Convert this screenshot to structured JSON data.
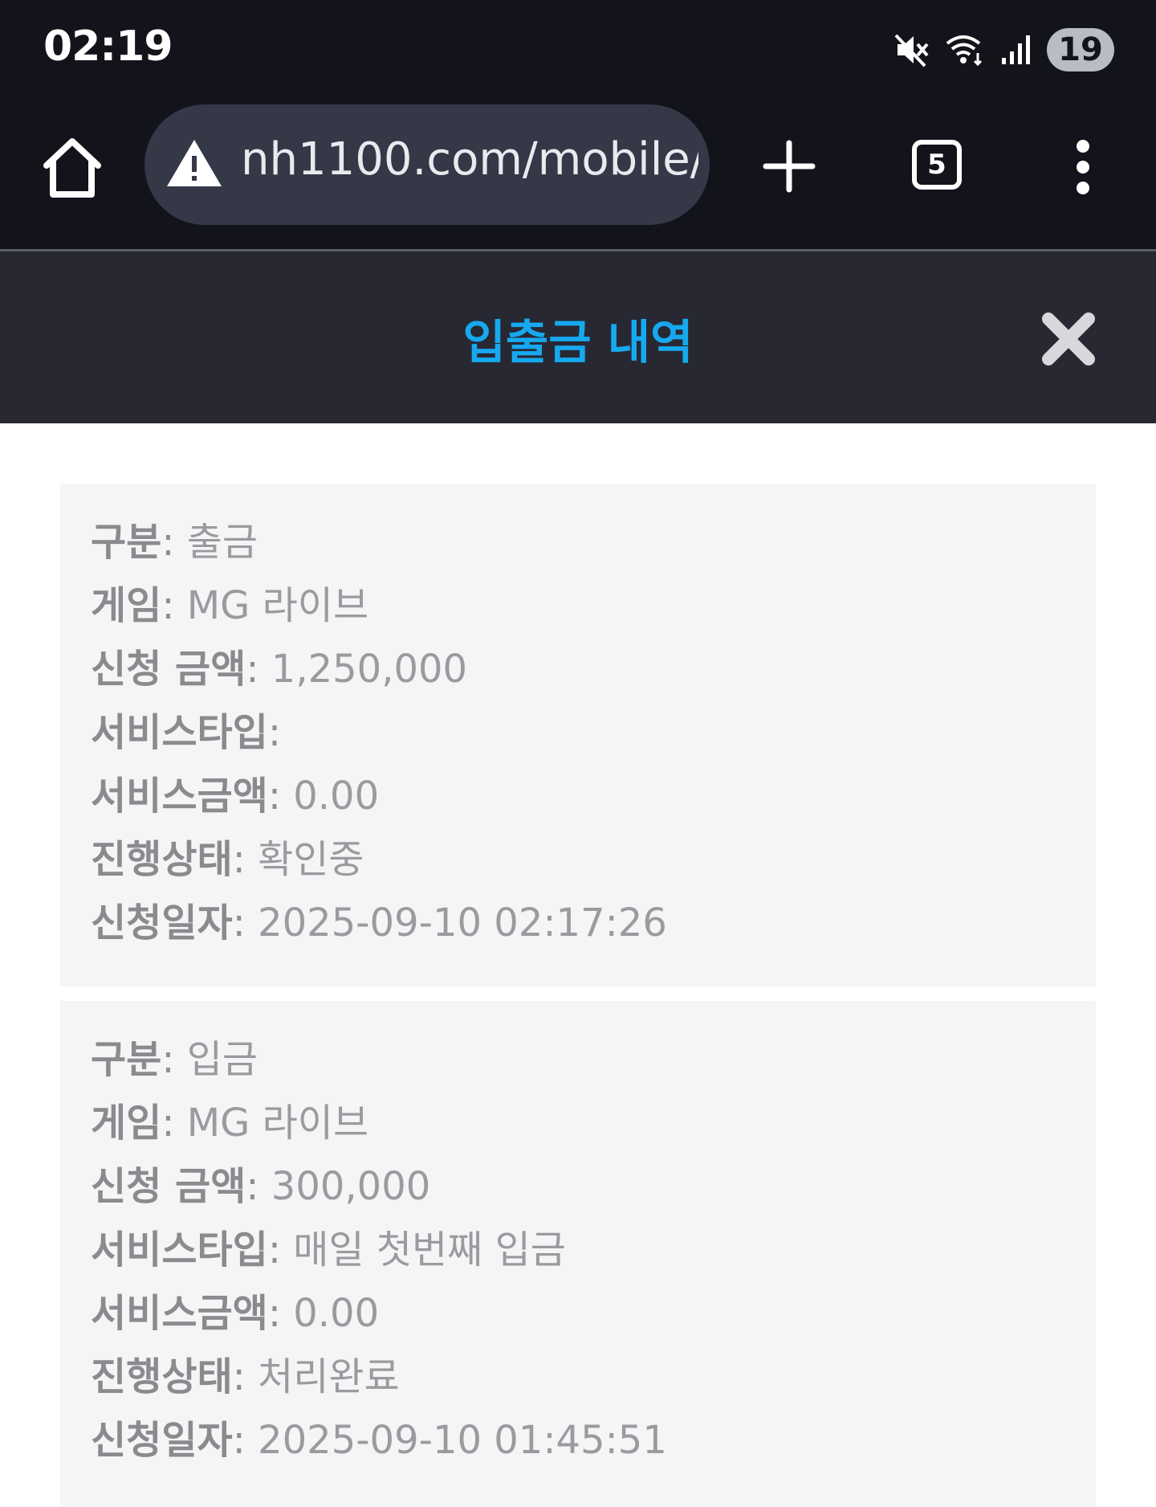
{
  "status_bar": {
    "time": "02:19",
    "icons": [
      "mute-icon",
      "wifi-icon",
      "signal-icon"
    ],
    "battery": "19"
  },
  "browser": {
    "url": "nh1100.com/mobile/#",
    "tab_count": "5",
    "icons": [
      "home-icon",
      "warning-icon",
      "plus-icon",
      "more-vert-icon"
    ]
  },
  "dialog": {
    "title": "입출금 내역",
    "close_icon": "close-icon",
    "accent_color": "#16a9f0"
  },
  "records": [
    {
      "type_label": "구분",
      "type_value": "출금",
      "game_label": "게임",
      "game_value": "MG 라이브",
      "amount_label": "신청 금액",
      "amount_value": "1,250,000",
      "service_type_label": "서비스타입",
      "service_type_value": "",
      "service_amount_label": "서비스금액",
      "service_amount_value": "0.00",
      "status_label": "진행상태",
      "status_value": "확인중",
      "date_label": "신청일자",
      "date_value": "2025-09-10 02:17:26"
    },
    {
      "type_label": "구분",
      "type_value": "입금",
      "game_label": "게임",
      "game_value": "MG 라이브",
      "amount_label": "신청 금액",
      "amount_value": "300,000",
      "service_type_label": "서비스타입",
      "service_type_value": "매일 첫번째 입금",
      "service_amount_label": "서비스금액",
      "service_amount_value": "0.00",
      "status_label": "진행상태",
      "status_value": "처리완료",
      "date_label": "신청일자",
      "date_value": "2025-09-10 01:45:51"
    }
  ]
}
